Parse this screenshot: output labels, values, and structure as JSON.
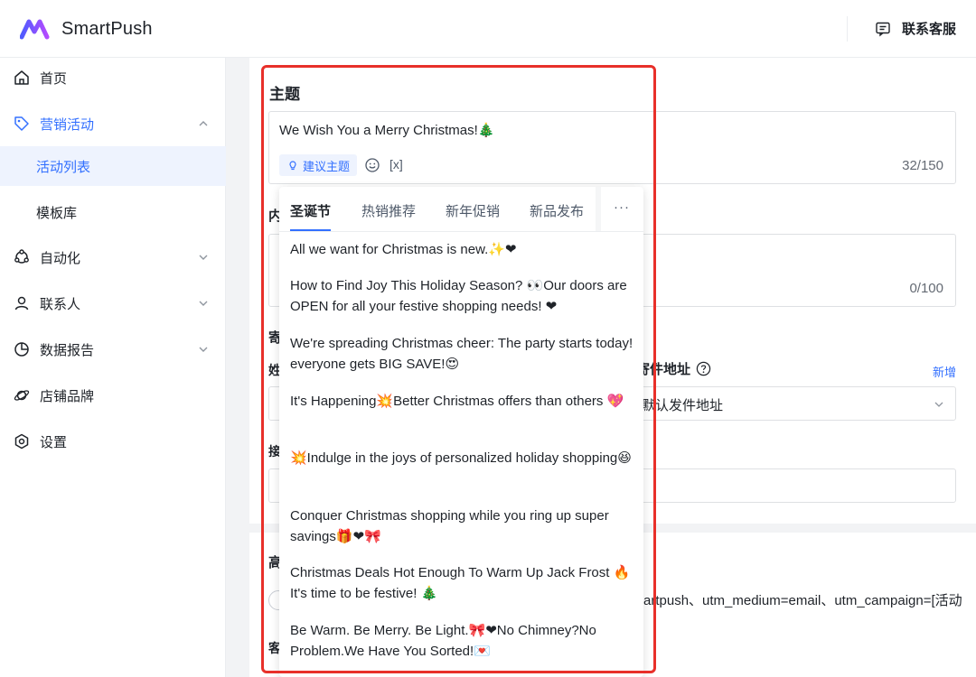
{
  "app": {
    "name": "SmartPush",
    "support_label": "联系客服"
  },
  "colors": {
    "accent": "#3370ff",
    "highlight_frame": "#e8302a"
  },
  "sidebar": {
    "items": [
      {
        "label": "首页",
        "icon": "home-icon"
      },
      {
        "label": "营销活动",
        "icon": "tag-icon",
        "expanded": true
      },
      {
        "label": "活动列表",
        "selected": true
      },
      {
        "label": "模板库"
      },
      {
        "label": "自动化",
        "icon": "automation-icon"
      },
      {
        "label": "联系人",
        "icon": "person-icon"
      },
      {
        "label": "数据报告",
        "icon": "pie-chart-icon"
      },
      {
        "label": "店铺品牌",
        "icon": "planet-icon"
      },
      {
        "label": "设置",
        "icon": "settings-icon"
      }
    ]
  },
  "form": {
    "subject_title": "主题",
    "subject_value": "We Wish You a Merry Christmas!🎄",
    "suggest_label": "建议主题",
    "var_label": "[x]",
    "subject_count": "32/150",
    "content_label_frag": "内",
    "content_count": "0/100",
    "sender_frag": "寄",
    "name_frag": "姓",
    "reply_label": "寄件地址",
    "add_label": "新增",
    "reply_select_value": "默认发件地址",
    "receive_frag": "接",
    "advanced_frag": "高",
    "utm_text": "artpush、utm_medium=email、utm_campaign=[活动",
    "customer_frag": "客"
  },
  "dropdown": {
    "tabs": [
      "圣诞节",
      "热销推荐",
      "新年促销",
      "新品发布"
    ],
    "active_tab": 0,
    "more_label": "···",
    "suggestions": [
      "All we want for Christmas is new.✨❤",
      "How to Find Joy This Holiday Season? 👀Our doors are OPEN for all your festive shopping needs! ❤",
      "We're spreading Christmas cheer: The party starts today! everyone gets BIG SAVE!😍",
      "It's Happening💥Better Christmas offers than others 💖",
      "💥Indulge in the joys of personalized holiday shopping😆",
      "Conquer Christmas shopping while you ring up super savings🎁❤🎀",
      "Christmas Deals Hot Enough To Warm Up Jack Frost 🔥It's time to be festive! 🎄",
      "Be Warm. Be Merry. Be Light.🎀❤No Chimney?No Problem.We Have You Sorted!💌"
    ]
  }
}
